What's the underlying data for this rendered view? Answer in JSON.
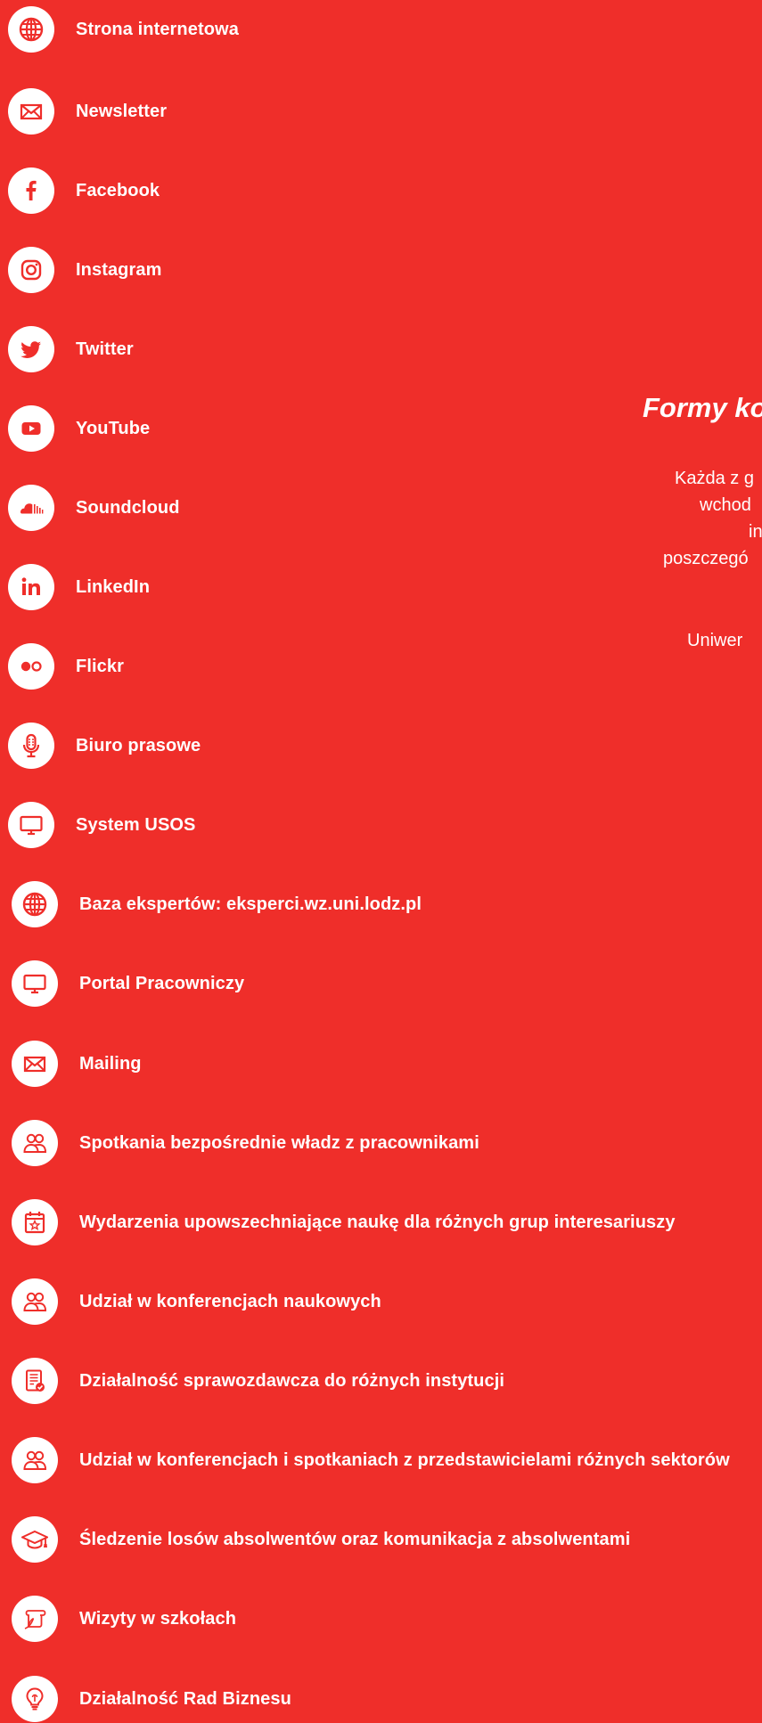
{
  "items": [
    {
      "label": "Strona internetowa",
      "icon": "globe-icon"
    },
    {
      "label": "Newsletter",
      "icon": "envelope-icon"
    },
    {
      "label": "Facebook",
      "icon": "facebook-icon"
    },
    {
      "label": "Instagram",
      "icon": "instagram-icon"
    },
    {
      "label": "Twitter",
      "icon": "twitter-icon"
    },
    {
      "label": "YouTube",
      "icon": "youtube-icon"
    },
    {
      "label": "Soundcloud",
      "icon": "soundcloud-icon"
    },
    {
      "label": "LinkedIn",
      "icon": "linkedin-icon"
    },
    {
      "label": "Flickr",
      "icon": "flickr-icon"
    },
    {
      "label": "Biuro prasowe",
      "icon": "microphone-icon"
    },
    {
      "label": "System USOS",
      "icon": "monitor-icon"
    },
    {
      "label": "Baza ekspertów: eksperci.wz.uni.lodz.pl",
      "icon": "globe-icon"
    },
    {
      "label": "Portal Pracowniczy",
      "icon": "monitor-icon"
    },
    {
      "label": "Mailing",
      "icon": "envelope-icon"
    },
    {
      "label": "Spotkania bezpośrednie władz z pracownikami",
      "icon": "people-icon"
    },
    {
      "label": "Wydarzenia upowszechniające naukę dla różnych grup interesariuszy",
      "icon": "calendar-star-icon"
    },
    {
      "label": "Udział w konferencjach naukowych",
      "icon": "people-icon"
    },
    {
      "label": "Działalność sprawozdawcza do różnych instytucji",
      "icon": "report-check-icon"
    },
    {
      "label": "Udział w konferencjach i spotkaniach z przedstawicielami różnych sektorów",
      "icon": "people-icon"
    },
    {
      "label": "Śledzenie losów absolwentów oraz komunikacja z absolwentami",
      "icon": "graduation-cap-icon"
    },
    {
      "label": "Wizyty w szkołach",
      "icon": "scroll-quill-icon"
    },
    {
      "label": "Działalność Rad Biznesu",
      "icon": "lightbulb-icon"
    }
  ],
  "right_panel": {
    "heading": "Formy ko",
    "lines": [
      "Każda z g",
      "wchod",
      "in",
      "poszczegó",
      "Uniwer"
    ]
  },
  "colors": {
    "background": "#ef2e2a",
    "icon_fill": "#ef2e2a",
    "circle": "#ffffff",
    "text": "#ffffff"
  }
}
